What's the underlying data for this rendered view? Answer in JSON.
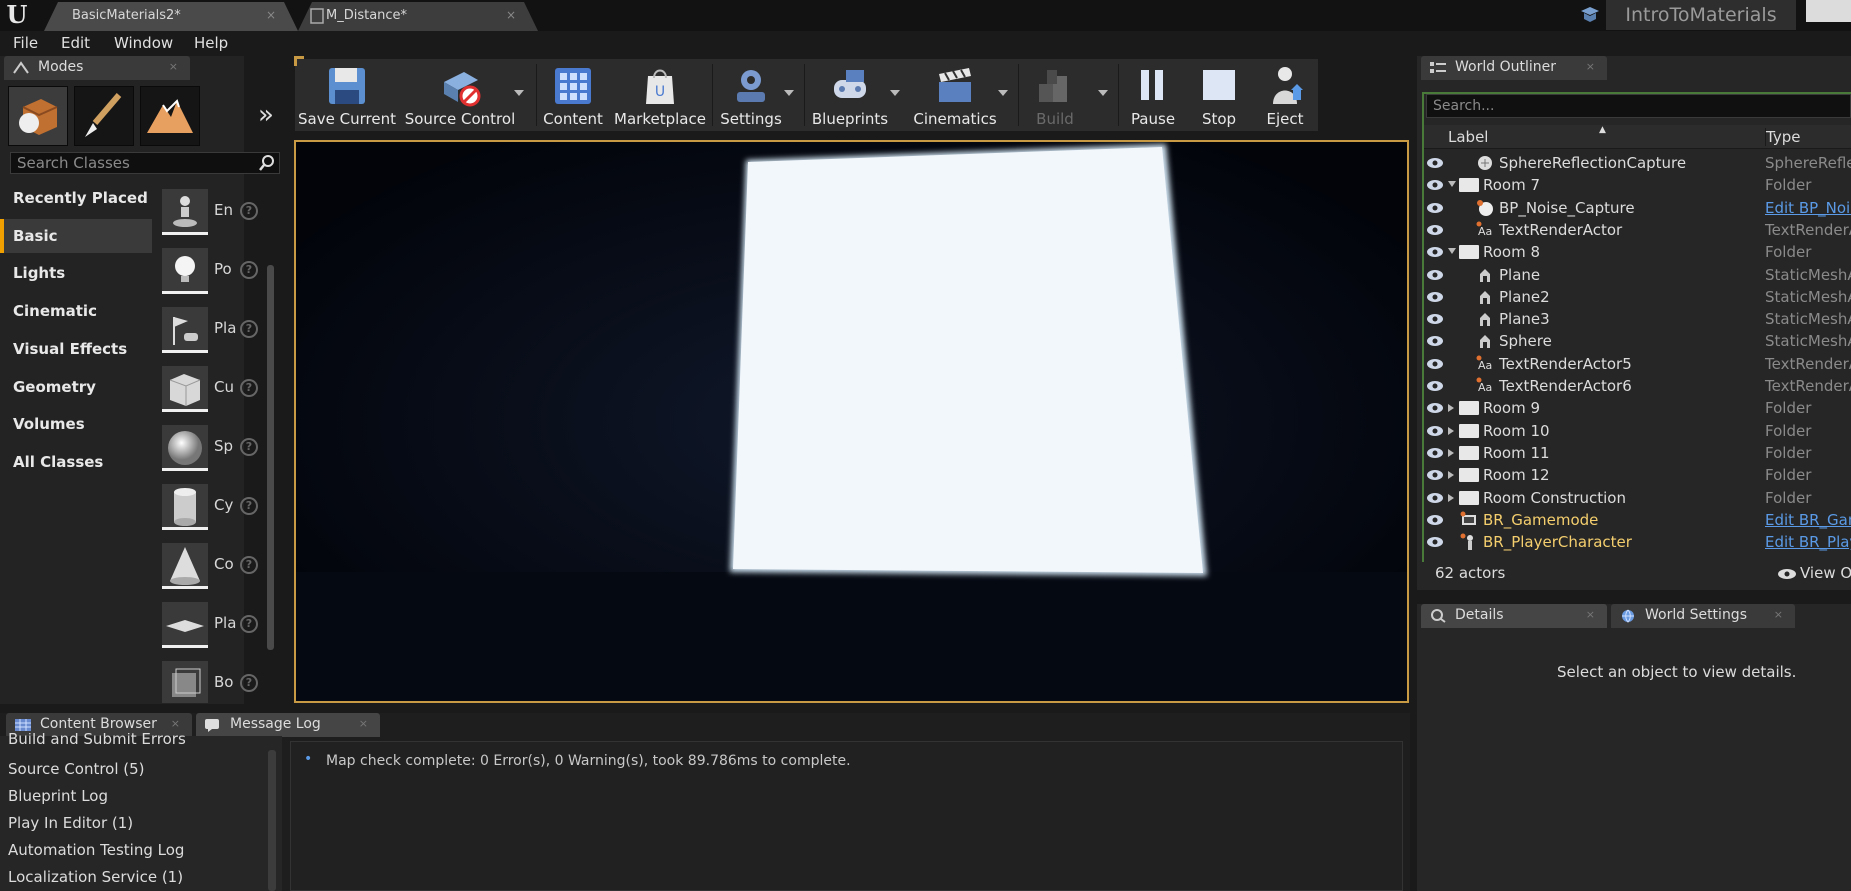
{
  "titlebar": {
    "tabs": [
      {
        "label": "BasicMaterials2*",
        "close": "×"
      },
      {
        "label": "M_Distance*",
        "close": "×"
      }
    ],
    "project": "IntroToMaterials"
  },
  "menu": [
    "File",
    "Edit",
    "Window",
    "Help"
  ],
  "modes": {
    "tab_label": "Modes",
    "close": "×",
    "expand": "»",
    "search_placeholder": "Search Classes",
    "categories": [
      "Recently Placed",
      "Basic",
      "Lights",
      "Cinematic",
      "Visual Effects",
      "Geometry",
      "Volumes",
      "All Classes"
    ],
    "active_category": "Basic",
    "items": [
      "En",
      "Po",
      "Pla",
      "Cu",
      "Sp",
      "Cy",
      "Co",
      "Pla",
      "Bo"
    ],
    "help_glyph": "?"
  },
  "toolbar": {
    "buttons": [
      {
        "label": "Save Current",
        "icon": "save-icon"
      },
      {
        "label": "Source Control",
        "icon": "source-control-icon",
        "dropdown": true
      },
      {
        "label": "Content",
        "icon": "content-icon"
      },
      {
        "label": "Marketplace",
        "icon": "marketplace-icon"
      },
      {
        "label": "Settings",
        "icon": "settings-icon",
        "dropdown": true
      },
      {
        "label": "Blueprints",
        "icon": "blueprints-icon",
        "dropdown": true
      },
      {
        "label": "Cinematics",
        "icon": "cinematics-icon",
        "dropdown": true
      },
      {
        "label": "Build",
        "icon": "build-icon",
        "dropdown": true,
        "disabled": true
      },
      {
        "label": "Pause",
        "icon": "pause-icon"
      },
      {
        "label": "Stop",
        "icon": "stop-icon"
      },
      {
        "label": "Eject",
        "icon": "eject-icon"
      }
    ]
  },
  "bottom": {
    "tabs": [
      {
        "label": "Content Browser",
        "close": "×"
      },
      {
        "label": "Message Log",
        "close": "×"
      }
    ],
    "log_categories": [
      "Build and Submit Errors",
      "Source Control (5)",
      "Blueprint Log",
      "Play In Editor (1)",
      "Automation Testing Log",
      "Localization Service (1)"
    ],
    "log_bullet": "•",
    "log_message": "Map check complete: 0 Error(s), 0 Warning(s), took 89.786ms to complete."
  },
  "outliner": {
    "tab_label": "World Outliner",
    "close": "×",
    "search_placeholder": "Search...",
    "col_label": "Label",
    "col_type": "Type",
    "rows": [
      {
        "label": "SphereReflectionCapture",
        "type": "SphereReflec",
        "indent": 2,
        "kind": "reflection"
      },
      {
        "label": "Room 7",
        "type": "Folder",
        "indent": 1,
        "kind": "folder",
        "expanded": true
      },
      {
        "label": "BP_Noise_Capture",
        "type": "Edit BP_Nois",
        "indent": 2,
        "kind": "sphere",
        "link": true
      },
      {
        "label": "TextRenderActor",
        "type": "TextRenderA",
        "indent": 2,
        "kind": "text"
      },
      {
        "label": "Room 8",
        "type": "Folder",
        "indent": 1,
        "kind": "folder",
        "expanded": true
      },
      {
        "label": "Plane",
        "type": "StaticMeshA",
        "indent": 2,
        "kind": "mesh"
      },
      {
        "label": "Plane2",
        "type": "StaticMeshA",
        "indent": 2,
        "kind": "mesh"
      },
      {
        "label": "Plane3",
        "type": "StaticMeshA",
        "indent": 2,
        "kind": "mesh"
      },
      {
        "label": "Sphere",
        "type": "StaticMeshA",
        "indent": 2,
        "kind": "mesh"
      },
      {
        "label": "TextRenderActor5",
        "type": "TextRenderA",
        "indent": 2,
        "kind": "text"
      },
      {
        "label": "TextRenderActor6",
        "type": "TextRenderA",
        "indent": 2,
        "kind": "text"
      },
      {
        "label": "Room 9",
        "type": "Folder",
        "indent": 1,
        "kind": "folder"
      },
      {
        "label": "Room 10",
        "type": "Folder",
        "indent": 1,
        "kind": "folder"
      },
      {
        "label": "Room 11",
        "type": "Folder",
        "indent": 1,
        "kind": "folder"
      },
      {
        "label": "Room 12",
        "type": "Folder",
        "indent": 1,
        "kind": "folder"
      },
      {
        "label": "Room Construction",
        "type": "Folder",
        "indent": 1,
        "kind": "folder"
      },
      {
        "label": "BR_Gamemode",
        "type": "Edit BR_Gam",
        "indent": 1,
        "kind": "gamemode",
        "link": true,
        "yellow": true
      },
      {
        "label": "BR_PlayerCharacter",
        "type": "Edit BR_Play",
        "indent": 1,
        "kind": "character",
        "link": true,
        "yellow": true
      }
    ],
    "actor_count": "62 actors",
    "view_options": "View Op"
  },
  "details": {
    "tabs": [
      {
        "label": "Details",
        "close": "×"
      },
      {
        "label": "World Settings",
        "close": "×"
      }
    ],
    "empty_text": "Select an object to view details."
  },
  "colors": {
    "accent": "#f0a000",
    "link": "#5a9ae6",
    "blueprint_yellow": "#f5cf6e",
    "viewport_border": "#c89a44"
  }
}
